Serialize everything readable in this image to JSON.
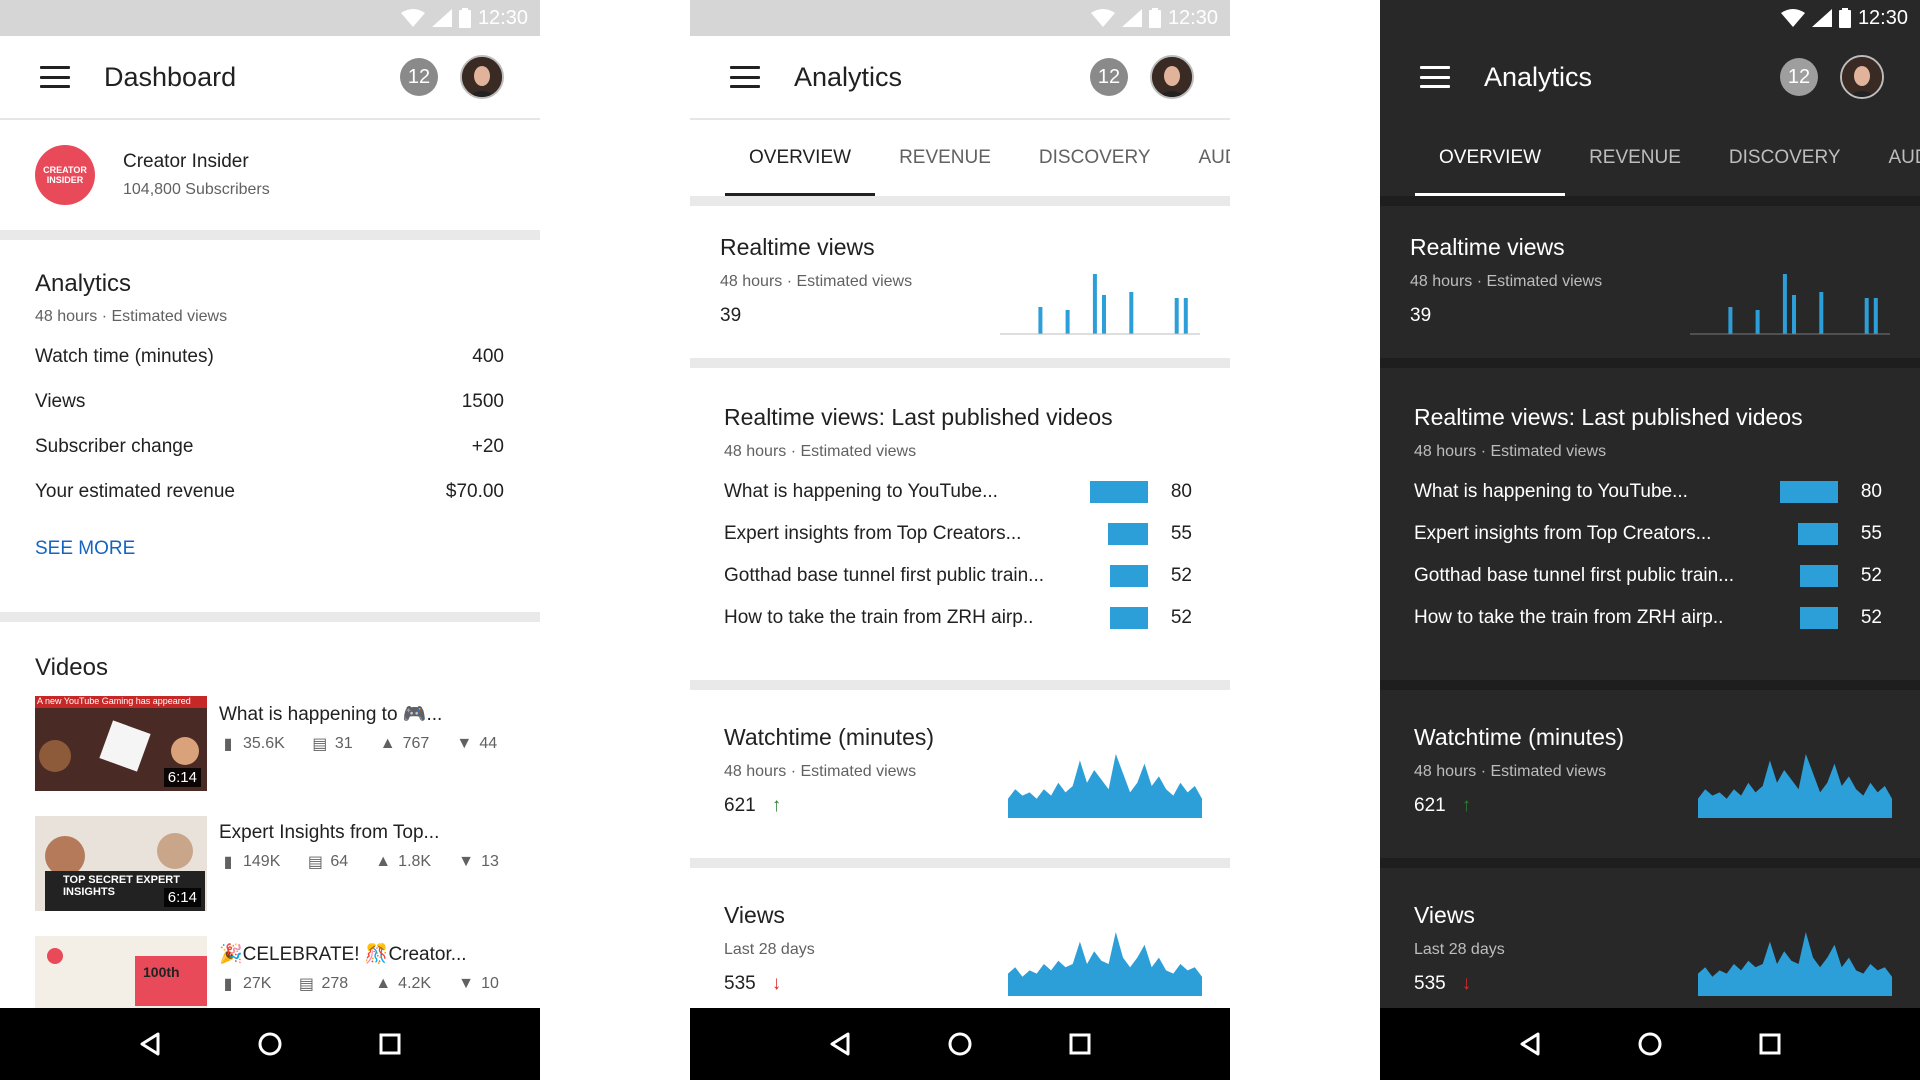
{
  "status_bar": {
    "time": "12:30"
  },
  "dashboard": {
    "title": "Dashboard",
    "notification_count": "12",
    "channel": {
      "logo_text": "CREATOR INSIDER",
      "name": "Creator Insider",
      "subscribers": "104,800 Subscribers"
    },
    "analytics": {
      "title": "Analytics",
      "subtitle": "48 hours · Estimated views",
      "metrics": [
        {
          "label": "Watch time (minutes)",
          "value": "400"
        },
        {
          "label": "Views",
          "value": "1500"
        },
        {
          "label": "Subscriber change",
          "value": "+20"
        },
        {
          "label": "Your estimated revenue",
          "value": "$70.00"
        }
      ],
      "see_more": "SEE MORE"
    },
    "videos": {
      "title": "Videos",
      "items": [
        {
          "title": "What is happening to 🎮...",
          "thumb_caption": "A new YouTube Gaming has appeared",
          "duration": "6:14",
          "views": "35.6K",
          "comments": "31",
          "likes": "767",
          "dislikes": "44"
        },
        {
          "title": "Expert Insights from Top...",
          "thumb_caption": "TOP SECRET EXPERT INSIGHTS",
          "duration": "6:14",
          "views": "149K",
          "comments": "64",
          "likes": "1.8K",
          "dislikes": "13"
        },
        {
          "title": "🎉CELEBRATE! 🎊Creator...",
          "thumb_caption": "100th",
          "duration": "",
          "views": "27K",
          "comments": "278",
          "likes": "4.2K",
          "dislikes": "10"
        }
      ]
    }
  },
  "analytics_screen": {
    "title": "Analytics",
    "notification_count": "12",
    "tabs": [
      "OVERVIEW",
      "REVENUE",
      "DISCOVERY",
      "AUD"
    ],
    "realtime": {
      "title": "Realtime views",
      "subtitle": "48 hours · Estimated views",
      "value": "39",
      "bars": [
        0,
        0,
        0,
        0,
        0.45,
        0,
        0,
        0.4,
        0,
        0,
        1,
        0.65,
        0,
        0,
        0.7,
        0,
        0,
        0,
        0,
        0.6,
        0.6,
        0
      ]
    },
    "last_published": {
      "title": "Realtime views: Last published videos",
      "subtitle": "48 hours · Estimated views",
      "rows": [
        {
          "title": "What is happening to YouTube...",
          "value": 80
        },
        {
          "title": "Expert insights from Top Creators...",
          "value": 55
        },
        {
          "title": "Gotthad base tunnel first public train...",
          "value": 52
        },
        {
          "title": "How to take the train from ZRH airp..",
          "value": 52
        }
      ],
      "bar_color": "#2d9fd8"
    },
    "watchtime": {
      "title": "Watchtime (minutes)",
      "subtitle": "48 hours · Estimated views",
      "value": "621",
      "trend": "up",
      "series": [
        0.3,
        0.45,
        0.35,
        0.4,
        0.3,
        0.45,
        0.35,
        0.55,
        0.4,
        0.5,
        0.9,
        0.55,
        0.75,
        0.6,
        0.45,
        1,
        0.7,
        0.4,
        0.55,
        0.85,
        0.5,
        0.65,
        0.45,
        0.35,
        0.55,
        0.4,
        0.5,
        0.3
      ]
    },
    "views": {
      "title": "Views",
      "subtitle": "Last 28 days",
      "value": "535",
      "trend": "down",
      "series": [
        0.35,
        0.45,
        0.3,
        0.4,
        0.35,
        0.5,
        0.4,
        0.55,
        0.45,
        0.5,
        0.85,
        0.5,
        0.7,
        0.55,
        0.5,
        1,
        0.6,
        0.45,
        0.6,
        0.8,
        0.45,
        0.6,
        0.4,
        0.35,
        0.5,
        0.4,
        0.45,
        0.3
      ]
    },
    "accent": "#2d9fd8",
    "trend_up_color": "#2e7d32",
    "trend_down_color": "#d32f2f"
  },
  "themes": [
    "light",
    "light",
    "dark"
  ]
}
